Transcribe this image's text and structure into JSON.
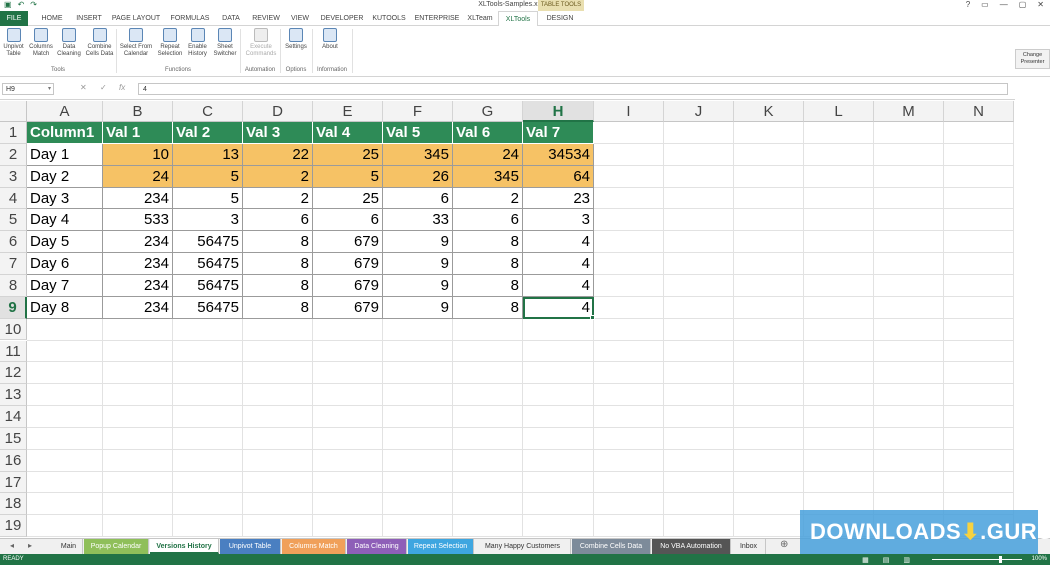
{
  "window": {
    "title": "XLTools-Samples.xlsm - Excel",
    "context_tab": "TABLE TOOLS",
    "controls": [
      "?",
      "▭",
      "—",
      "▢",
      "✕"
    ]
  },
  "qat": [
    "save-icon",
    "undo-icon",
    "redo-icon"
  ],
  "ribbon_tabs": [
    "FILE",
    "HOME",
    "INSERT",
    "PAGE LAYOUT",
    "FORMULAS",
    "DATA",
    "REVIEW",
    "VIEW",
    "DEVELOPER",
    "KUTOOLS",
    "ENTERPRISE",
    "XLTeam",
    "XLTools",
    "DESIGN"
  ],
  "active_ribbon_tab": "XLTools",
  "ribbon": {
    "buttons": [
      {
        "label1": "Unpivot",
        "label2": "Table",
        "icon": "table-icon"
      },
      {
        "label1": "Columns",
        "label2": "Match",
        "icon": "columns-icon"
      },
      {
        "label1": "Data",
        "label2": "Cleaning",
        "icon": "broom-icon"
      },
      {
        "label1": "Combine",
        "label2": "Cells Data",
        "icon": "combine-icon"
      },
      {
        "label1": "Select From",
        "label2": "Calendar",
        "icon": "calendar-icon"
      },
      {
        "label1": "Repeat",
        "label2": "Selection",
        "icon": "repeat-icon"
      },
      {
        "label1": "Enable",
        "label2": "History",
        "icon": "history-icon"
      },
      {
        "label1": "Sheet",
        "label2": "Switcher",
        "icon": "switch-icon"
      },
      {
        "label1": "Execute",
        "label2": "Commands",
        "icon": "execute-icon"
      },
      {
        "label1": "Settings",
        "label2": "",
        "icon": "gear-icon"
      },
      {
        "label1": "About",
        "label2": "",
        "icon": "info-icon"
      }
    ],
    "groups": [
      "Tools",
      "Functions",
      "Automation",
      "Options",
      "Information"
    ],
    "change_presenter": "Change Presenter"
  },
  "formula_bar": {
    "name_box": "H9",
    "value": "4"
  },
  "columns": [
    "A",
    "B",
    "C",
    "D",
    "E",
    "F",
    "G",
    "H",
    "I",
    "J",
    "K",
    "L",
    "M",
    "N"
  ],
  "rows": [
    "1",
    "2",
    "3",
    "4",
    "5",
    "6",
    "7",
    "8",
    "9",
    "10",
    "11",
    "12",
    "13",
    "14",
    "15",
    "16",
    "17",
    "18",
    "19"
  ],
  "selected_column": "H",
  "selected_row": "9",
  "table": {
    "header": [
      "Column1",
      "Val 1",
      "Val 2",
      "Val 3",
      "Val 4",
      "Val 5",
      "Val 6",
      "Val 7"
    ],
    "rows": [
      [
        "Day 1",
        "10",
        "13",
        "22",
        "25",
        "345",
        "24",
        "34534"
      ],
      [
        "Day 2",
        "24",
        "5",
        "2",
        "5",
        "26",
        "345",
        "64"
      ],
      [
        "Day 3",
        "234",
        "5",
        "2",
        "25",
        "6",
        "2",
        "23"
      ],
      [
        "Day 4",
        "533",
        "3",
        "6",
        "6",
        "33",
        "6",
        "3"
      ],
      [
        "Day 5",
        "234",
        "56475",
        "8",
        "679",
        "9",
        "8",
        "4"
      ],
      [
        "Day 6",
        "234",
        "56475",
        "8",
        "679",
        "9",
        "8",
        "4"
      ],
      [
        "Day 7",
        "234",
        "56475",
        "8",
        "679",
        "9",
        "8",
        "4"
      ],
      [
        "Day 8",
        "234",
        "56475",
        "8",
        "679",
        "9",
        "8",
        "4"
      ]
    ],
    "highlighted_rows": [
      0,
      1
    ],
    "colors": {
      "header_bg": "#2e8b57",
      "highlight_bg": "#f6c265"
    }
  },
  "sheet_tabs": [
    {
      "label": "Main",
      "color": ""
    },
    {
      "label": "Popup Calendar",
      "color": "#8fbf5a"
    },
    {
      "label": "Versions History",
      "color": "",
      "active": true
    },
    {
      "label": "Unpivot Table",
      "color": "#4a7fc1"
    },
    {
      "label": "Columns Match",
      "color": "#f0a05a"
    },
    {
      "label": "Data Cleaning",
      "color": "#8e5fb8"
    },
    {
      "label": "Repeat Selection",
      "color": "#3ea6e0"
    },
    {
      "label": "Many Happy Customers",
      "color": ""
    },
    {
      "label": "Combine Cells Data",
      "color": "#7d8b9a"
    },
    {
      "label": "No VBA Automation",
      "color": "#555555"
    },
    {
      "label": "Inbox",
      "color": ""
    }
  ],
  "status": {
    "ready": "READY",
    "zoom": "100%"
  },
  "watermark": {
    "text1": "DOWNLOADS",
    "mark": "⬇",
    "text2": ".GURU"
  }
}
